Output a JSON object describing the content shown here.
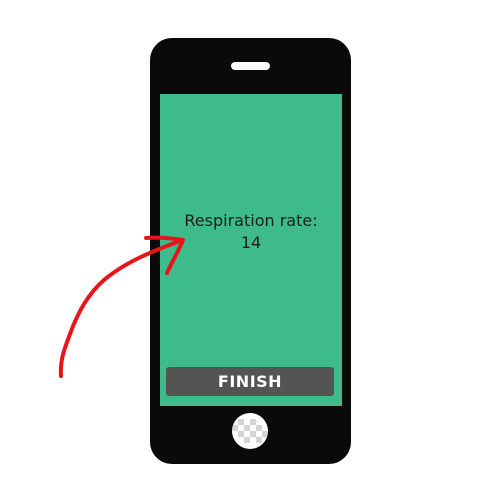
{
  "screen": {
    "label": "Respiration rate:",
    "value": "14"
  },
  "actions": {
    "finish_label": "FINISH"
  },
  "colors": {
    "phone_body": "#0a0a0a",
    "screen": "#3dbb8a",
    "button": "#545454",
    "annotation": "#e8141b"
  },
  "icons": {
    "home": "home-button-icon",
    "annotation": "arrow-icon"
  }
}
